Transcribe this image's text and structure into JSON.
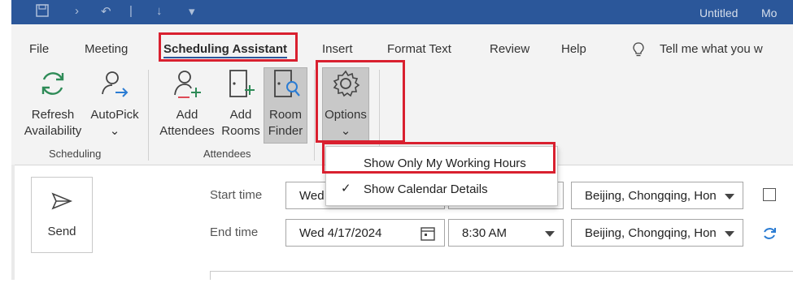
{
  "window": {
    "title": "Untitled",
    "account_initials": "Mo"
  },
  "tabs": [
    {
      "label": "File"
    },
    {
      "label": "Meeting"
    },
    {
      "label": "Scheduling Assistant"
    },
    {
      "label": "Insert"
    },
    {
      "label": "Format Text"
    },
    {
      "label": "Review"
    },
    {
      "label": "Help"
    }
  ],
  "tell_me": {
    "text": "Tell me what you w"
  },
  "ribbon": {
    "refresh": {
      "line1": "Refresh",
      "line2": "Availability"
    },
    "autopick": {
      "line1": "AutoPick",
      "line2": "⌄"
    },
    "add_attendees": {
      "line1": "Add",
      "line2": "Attendees"
    },
    "add_rooms": {
      "line1": "Add",
      "line2": "Rooms"
    },
    "room_finder": {
      "line1": "Room",
      "line2": "Finder"
    },
    "options": {
      "line1": "Options",
      "line2": "⌄"
    },
    "group_scheduling": "Scheduling",
    "group_attendees": "Attendees"
  },
  "options_menu": {
    "items": [
      {
        "label": "Show Only My Working Hours",
        "checked": false
      },
      {
        "label": "Show Calendar Details",
        "checked": true
      }
    ],
    "check_glyph": "✓"
  },
  "send": {
    "label": "Send"
  },
  "form": {
    "start_label": "Start time",
    "end_label": "End time",
    "start_date": "Wed",
    "end_date": "Wed 4/17/2024",
    "end_time": "8:30 AM",
    "start_tz": "Beijing, Chongqing, Hon",
    "end_tz": "Beijing, Chongqing, Hon"
  },
  "colors": {
    "accent": "#2b579a",
    "highlight": "#d9202f",
    "icon_green": "#2e8b57",
    "icon_blue": "#2b7cd3"
  }
}
